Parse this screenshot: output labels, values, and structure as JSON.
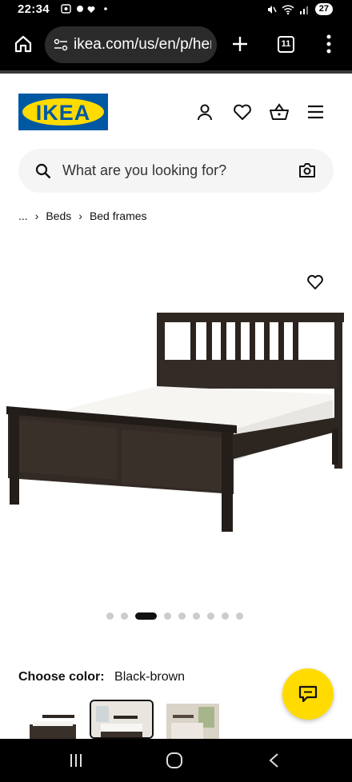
{
  "status_bar": {
    "time": "22:34",
    "battery": "27"
  },
  "browser": {
    "url": "ikea.com/us/en/p/hem",
    "tab_count": "11"
  },
  "header": {
    "logo_text": "IKEA"
  },
  "search": {
    "placeholder": "What are you looking for?"
  },
  "breadcrumb": {
    "items": [
      "...",
      "Beds",
      "Bed frames"
    ]
  },
  "carousel": {
    "total": 9,
    "active_index": 2
  },
  "product": {
    "choose_color_label": "Choose color:",
    "color_value": "Black-brown"
  },
  "colors": {
    "brand_blue": "#0058a3",
    "brand_yellow": "#ffdb00"
  }
}
